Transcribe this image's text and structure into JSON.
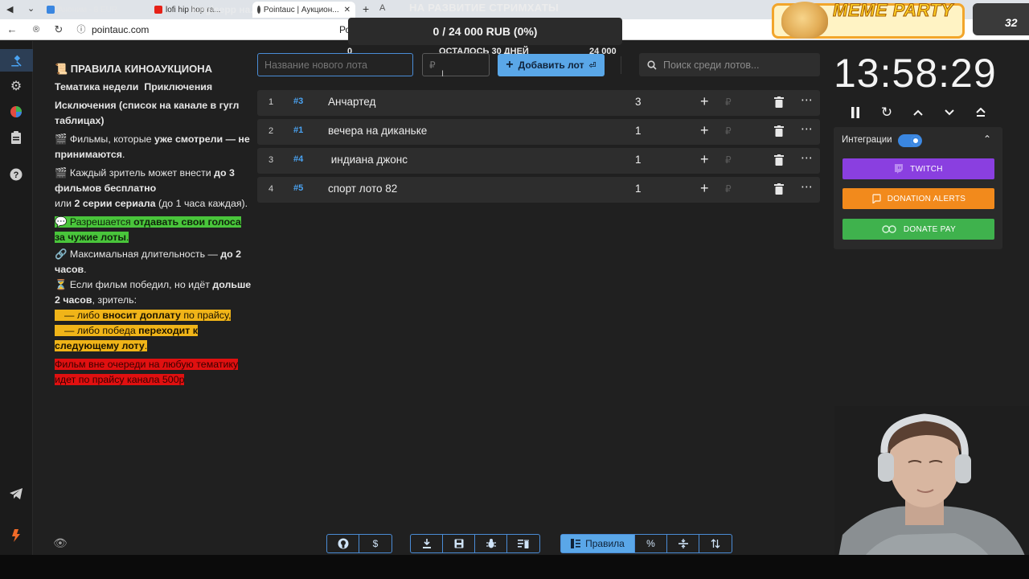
{
  "browser": {
    "tabs": [
      {
        "label": "Аноним - 8 EUR"
      },
      {
        "label": "lofi hip hop ra..."
      },
      {
        "label": "kingisepp на... 500 RUB"
      },
      {
        "label": "Pointauc | Аукцион..."
      },
      {
        "label": "А"
      }
    ],
    "url": "pointauc.com",
    "partial_text": "Ро"
  },
  "overlay": {
    "goal_title": "НА РАЗВИТИЕ СТРИМХАТЫ",
    "goal_progress": "0 / 24 000 RUB (0%)",
    "goal_min": "0",
    "goal_remaining": "ОСТАЛОСЬ 30 ДНЕЙ",
    "goal_max": "24 000",
    "meme_title": "MEME PARTY",
    "meme_count": "32"
  },
  "rules": {
    "title": "📜 ПРАВИЛА КИНОАУКЦИОНА",
    "theme_label": "Тематика недели",
    "theme_value": "Приключения",
    "exclusions": "Исключения (список на канале в гугл таблицах)",
    "r1_pre": "🎬 Фильмы, которые ",
    "r1_bold": "уже смотрели — не принимаются",
    "r1_post": ".",
    "r2_pre": "🎬 Каждый зритель может внести ",
    "r2_bold1": "до 3 фильмов бесплатно",
    "r2_mid": "или ",
    "r2_bold2": "2 серии сериала",
    "r2_post": " (до 1 часа каждая).",
    "r3_pre": "💬 Разрешается ",
    "r3_bold": "отдавать свои голоса за чужие лоты",
    "r3_post": ".",
    "r4_pre": "🔗 Максимальная длительность — ",
    "r4_bold": "до 2 часов",
    "r4_post": ".",
    "r5_pre": "⏳ Если фильм победил, но идёт ",
    "r5_bold": "дольше 2 часов",
    "r5_post": ", зритель:",
    "r6_pre": "— либо ",
    "r6_bold": "вносит доплату",
    "r6_post": " по прайсу,",
    "r7_pre": "— либо победа ",
    "r7_bold": "переходит к следующему лоту",
    "r7_post": ".",
    "r8": "Фильм вне очереди на любую тематику идет по прайсу канала 500р"
  },
  "toolbar": {
    "lot_name_placeholder": "Название нового лота",
    "amount_placeholder": "₽",
    "add_lot_label": "Добавить лот",
    "search_placeholder": "Поиск среди лотов..."
  },
  "lots": [
    {
      "index": "1",
      "id": "#3",
      "name": "Анчартед",
      "amount": "3"
    },
    {
      "index": "2",
      "id": "#1",
      "name": "вечера на диканьке",
      "amount": "1"
    },
    {
      "index": "3",
      "id": "#4",
      "name": " индиана джонс",
      "amount": "1"
    },
    {
      "index": "4",
      "id": "#5",
      "name": "спорт лото 82",
      "amount": "1"
    }
  ],
  "currency_symbol": "₽",
  "timer": {
    "value": "13:58:29"
  },
  "integrations": {
    "label": "Интеграции",
    "enabled": true,
    "twitch_label": "TWITCH",
    "donation_alerts_label": "DONATION ALERTS",
    "donate_pay_label": "DONATE PAY",
    "colors": {
      "twitch": "#8a3fe0",
      "donation_alerts": "#f28a1c",
      "donate_pay": "#3fb24d"
    }
  },
  "bottom_toolbar": {
    "rules_label": "Правила"
  },
  "colors": {
    "accent": "#5aa7e8",
    "background": "#202020",
    "row": "#2d2d2d"
  }
}
